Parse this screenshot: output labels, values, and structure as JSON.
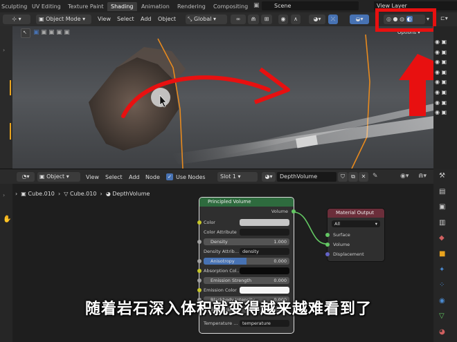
{
  "tabs": [
    "Sculpting",
    "UV Editing",
    "Texture Paint",
    "Shading",
    "Animation",
    "Rendering",
    "Compositing"
  ],
  "scene_name": "Scene",
  "view_layer": "View Layer",
  "viewport_header": {
    "mode": "Object Mode",
    "menus": [
      "View",
      "Select",
      "Add",
      "Object"
    ],
    "orientation": "Global",
    "options_label": "Options"
  },
  "node_header": {
    "type": "Object",
    "menus": [
      "View",
      "Select",
      "Add",
      "Node"
    ],
    "use_nodes_label": "Use Nodes",
    "slot": "Slot 1",
    "material": "DepthVolume"
  },
  "breadcrumb": [
    "Cube.010",
    "Cube.010",
    "DepthVolume"
  ],
  "principled_volume": {
    "title": "Principled Volume",
    "output_label": "Volume",
    "rows": {
      "color": "Color",
      "color_attribute": "Color Attribute",
      "density_label": "Density",
      "density_value": "1.000",
      "density_attribute_label": "Density Attrib...",
      "density_attribute_value": "density",
      "anisotropy_label": "Anisotropy",
      "anisotropy_value": "0.000",
      "absorption_color": "Absorption Col...",
      "emission_strength_label": "Emission Strength",
      "emission_strength_value": "0.000",
      "emission_color": "Emission Color",
      "blackbody_label": "Blackbody Intensity",
      "blackbody_value": "0.000",
      "temperature_label": "Temperature",
      "temperature_value": "1000.000",
      "temperature_attr_label": "Temperature ...",
      "temperature_attr_value": "temperature"
    }
  },
  "material_output": {
    "title": "Material Output",
    "target": "All",
    "inputs": [
      "Surface",
      "Volume",
      "Displacement"
    ]
  },
  "subtitle": "随着岩石深入体积就变得越来越难看到了",
  "colors": {
    "node_header_volume": "#2e6b3e",
    "node_header_output": "#6b2e3a",
    "annotation_red": "#e81010",
    "viewport_bg": "#47494c",
    "socket_green": "#63c763",
    "socket_yellow": "#c7c729",
    "socket_grey": "#a1a1a1",
    "socket_blue": "#6363c7",
    "anisotropy_blue": "#4772b3"
  }
}
